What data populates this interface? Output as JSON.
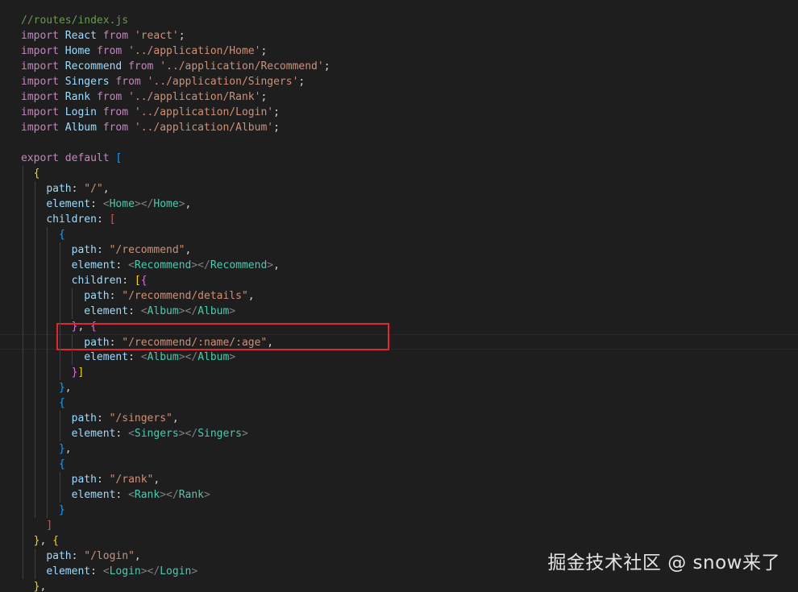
{
  "file_comment": "//routes/index.js",
  "colors": {
    "background": "#1e1e1e",
    "comment": "#6a9955",
    "keyword": "#c586c0",
    "variable": "#9cdcfe",
    "string": "#ce9178",
    "tag": "#4ec9b0",
    "highlight_box": "#e0262e"
  },
  "lines": [
    [
      {
        "c": "t-comment",
        "t": "//routes/index.js"
      }
    ],
    [
      {
        "c": "t-keyword",
        "t": "import"
      },
      {
        "c": "t-plain",
        "t": " "
      },
      {
        "c": "t-var",
        "t": "React"
      },
      {
        "c": "t-plain",
        "t": " "
      },
      {
        "c": "t-keyword",
        "t": "from"
      },
      {
        "c": "t-plain",
        "t": " "
      },
      {
        "c": "t-string",
        "t": "'react'"
      },
      {
        "c": "t-plain",
        "t": ";"
      }
    ],
    [
      {
        "c": "t-keyword",
        "t": "import"
      },
      {
        "c": "t-plain",
        "t": " "
      },
      {
        "c": "t-var",
        "t": "Home"
      },
      {
        "c": "t-plain",
        "t": " "
      },
      {
        "c": "t-keyword",
        "t": "from"
      },
      {
        "c": "t-plain",
        "t": " "
      },
      {
        "c": "t-string",
        "t": "'../application/Home'"
      },
      {
        "c": "t-plain",
        "t": ";"
      }
    ],
    [
      {
        "c": "t-keyword",
        "t": "import"
      },
      {
        "c": "t-plain",
        "t": " "
      },
      {
        "c": "t-var",
        "t": "Recommend"
      },
      {
        "c": "t-plain",
        "t": " "
      },
      {
        "c": "t-keyword",
        "t": "from"
      },
      {
        "c": "t-plain",
        "t": " "
      },
      {
        "c": "t-string",
        "t": "'../application/Recommend'"
      },
      {
        "c": "t-plain",
        "t": ";"
      }
    ],
    [
      {
        "c": "t-keyword",
        "t": "import"
      },
      {
        "c": "t-plain",
        "t": " "
      },
      {
        "c": "t-var",
        "t": "Singers"
      },
      {
        "c": "t-plain",
        "t": " "
      },
      {
        "c": "t-keyword",
        "t": "from"
      },
      {
        "c": "t-plain",
        "t": " "
      },
      {
        "c": "t-string",
        "t": "'../application/Singers'"
      },
      {
        "c": "t-plain",
        "t": ";"
      }
    ],
    [
      {
        "c": "t-keyword",
        "t": "import"
      },
      {
        "c": "t-plain",
        "t": " "
      },
      {
        "c": "t-var",
        "t": "Rank"
      },
      {
        "c": "t-plain",
        "t": " "
      },
      {
        "c": "t-keyword",
        "t": "from"
      },
      {
        "c": "t-plain",
        "t": " "
      },
      {
        "c": "t-string",
        "t": "'../application/Rank'"
      },
      {
        "c": "t-plain",
        "t": ";"
      }
    ],
    [
      {
        "c": "t-keyword",
        "t": "import"
      },
      {
        "c": "t-plain",
        "t": " "
      },
      {
        "c": "t-var",
        "t": "Login"
      },
      {
        "c": "t-plain",
        "t": " "
      },
      {
        "c": "t-keyword",
        "t": "from"
      },
      {
        "c": "t-plain",
        "t": " "
      },
      {
        "c": "t-string",
        "t": "'../application/Login'"
      },
      {
        "c": "t-plain",
        "t": ";"
      }
    ],
    [
      {
        "c": "t-keyword",
        "t": "import"
      },
      {
        "c": "t-plain",
        "t": " "
      },
      {
        "c": "t-var",
        "t": "Album"
      },
      {
        "c": "t-plain",
        "t": " "
      },
      {
        "c": "t-keyword",
        "t": "from"
      },
      {
        "c": "t-plain",
        "t": " "
      },
      {
        "c": "t-string",
        "t": "'../application/Album'"
      },
      {
        "c": "t-plain",
        "t": ";"
      }
    ],
    [],
    [
      {
        "c": "t-keyword",
        "t": "export"
      },
      {
        "c": "t-plain",
        "t": " "
      },
      {
        "c": "t-keyword",
        "t": "default"
      },
      {
        "c": "t-plain",
        "t": " "
      },
      {
        "c": "t-bracket-b",
        "t": "["
      }
    ],
    [
      {
        "c": "t-plain",
        "t": "  "
      },
      {
        "c": "t-bracket-y",
        "t": "{"
      }
    ],
    [
      {
        "c": "t-plain",
        "t": "    "
      },
      {
        "c": "t-var",
        "t": "path"
      },
      {
        "c": "t-plain",
        "t": ": "
      },
      {
        "c": "t-string",
        "t": "\"/\""
      },
      {
        "c": "t-plain",
        "t": ","
      }
    ],
    [
      {
        "c": "t-plain",
        "t": "    "
      },
      {
        "c": "t-var",
        "t": "element"
      },
      {
        "c": "t-plain",
        "t": ": "
      },
      {
        "c": "t-tagbr",
        "t": "<"
      },
      {
        "c": "t-tag",
        "t": "Home"
      },
      {
        "c": "t-tagbr",
        "t": "></"
      },
      {
        "c": "t-tag",
        "t": "Home"
      },
      {
        "c": "t-tagbr",
        "t": ">"
      },
      {
        "c": "t-plain",
        "t": ","
      }
    ],
    [
      {
        "c": "t-plain",
        "t": "    "
      },
      {
        "c": "t-var",
        "t": "children"
      },
      {
        "c": "t-plain",
        "t": ": "
      },
      {
        "c": "t-bracket-red",
        "t": "["
      }
    ],
    [
      {
        "c": "t-plain",
        "t": "      "
      },
      {
        "c": "t-bracket-b",
        "t": "{"
      }
    ],
    [
      {
        "c": "t-plain",
        "t": "        "
      },
      {
        "c": "t-var",
        "t": "path"
      },
      {
        "c": "t-plain",
        "t": ": "
      },
      {
        "c": "t-string",
        "t": "\"/recommend\""
      },
      {
        "c": "t-plain",
        "t": ","
      }
    ],
    [
      {
        "c": "t-plain",
        "t": "        "
      },
      {
        "c": "t-var",
        "t": "element"
      },
      {
        "c": "t-plain",
        "t": ": "
      },
      {
        "c": "t-tagbr",
        "t": "<"
      },
      {
        "c": "t-tag",
        "t": "Recommend"
      },
      {
        "c": "t-tagbr",
        "t": "></"
      },
      {
        "c": "t-tag",
        "t": "Recommend"
      },
      {
        "c": "t-tagbr",
        "t": ">"
      },
      {
        "c": "t-plain",
        "t": ","
      }
    ],
    [
      {
        "c": "t-plain",
        "t": "        "
      },
      {
        "c": "t-var",
        "t": "children"
      },
      {
        "c": "t-plain",
        "t": ": "
      },
      {
        "c": "t-bracket-y",
        "t": "["
      },
      {
        "c": "t-bracket-p",
        "t": "{"
      }
    ],
    [
      {
        "c": "t-plain",
        "t": "          "
      },
      {
        "c": "t-var",
        "t": "path"
      },
      {
        "c": "t-plain",
        "t": ": "
      },
      {
        "c": "t-string",
        "t": "\"/recommend/details\""
      },
      {
        "c": "t-plain",
        "t": ","
      }
    ],
    [
      {
        "c": "t-plain",
        "t": "          "
      },
      {
        "c": "t-var",
        "t": "element"
      },
      {
        "c": "t-plain",
        "t": ": "
      },
      {
        "c": "t-tagbr",
        "t": "<"
      },
      {
        "c": "t-tag",
        "t": "Album"
      },
      {
        "c": "t-tagbr",
        "t": "></"
      },
      {
        "c": "t-tag",
        "t": "Album"
      },
      {
        "c": "t-tagbr",
        "t": ">"
      }
    ],
    [
      {
        "c": "t-plain",
        "t": "        "
      },
      {
        "c": "t-bracket-p",
        "t": "}"
      },
      {
        "c": "t-plain",
        "t": ", "
      },
      {
        "c": "t-bracket-p",
        "t": "{"
      }
    ],
    [
      {
        "c": "t-plain",
        "t": "          "
      },
      {
        "c": "t-var",
        "t": "path"
      },
      {
        "c": "t-plain",
        "t": ": "
      },
      {
        "c": "t-string",
        "t": "\"/recommend/:name/:age\""
      },
      {
        "c": "t-plain",
        "t": ","
      }
    ],
    [
      {
        "c": "t-plain",
        "t": "          "
      },
      {
        "c": "t-var",
        "t": "element"
      },
      {
        "c": "t-plain",
        "t": ": "
      },
      {
        "c": "t-tagbr",
        "t": "<"
      },
      {
        "c": "t-tag",
        "t": "Album"
      },
      {
        "c": "t-tagbr",
        "t": "></"
      },
      {
        "c": "t-tag",
        "t": "Album"
      },
      {
        "c": "t-tagbr",
        "t": ">"
      }
    ],
    [
      {
        "c": "t-plain",
        "t": "        "
      },
      {
        "c": "t-bracket-p",
        "t": "}"
      },
      {
        "c": "t-bracket-y",
        "t": "]"
      }
    ],
    [
      {
        "c": "t-plain",
        "t": "      "
      },
      {
        "c": "t-bracket-b",
        "t": "}"
      },
      {
        "c": "t-plain",
        "t": ","
      }
    ],
    [
      {
        "c": "t-plain",
        "t": "      "
      },
      {
        "c": "t-bracket-b",
        "t": "{"
      }
    ],
    [
      {
        "c": "t-plain",
        "t": "        "
      },
      {
        "c": "t-var",
        "t": "path"
      },
      {
        "c": "t-plain",
        "t": ": "
      },
      {
        "c": "t-string",
        "t": "\"/singers\""
      },
      {
        "c": "t-plain",
        "t": ","
      }
    ],
    [
      {
        "c": "t-plain",
        "t": "        "
      },
      {
        "c": "t-var",
        "t": "element"
      },
      {
        "c": "t-plain",
        "t": ": "
      },
      {
        "c": "t-tagbr",
        "t": "<"
      },
      {
        "c": "t-tag",
        "t": "Singers"
      },
      {
        "c": "t-tagbr",
        "t": "></"
      },
      {
        "c": "t-tag",
        "t": "Singers"
      },
      {
        "c": "t-tagbr",
        "t": ">"
      }
    ],
    [
      {
        "c": "t-plain",
        "t": "      "
      },
      {
        "c": "t-bracket-b",
        "t": "}"
      },
      {
        "c": "t-plain",
        "t": ","
      }
    ],
    [
      {
        "c": "t-plain",
        "t": "      "
      },
      {
        "c": "t-bracket-b",
        "t": "{"
      }
    ],
    [
      {
        "c": "t-plain",
        "t": "        "
      },
      {
        "c": "t-var",
        "t": "path"
      },
      {
        "c": "t-plain",
        "t": ": "
      },
      {
        "c": "t-string",
        "t": "\"/rank\""
      },
      {
        "c": "t-plain",
        "t": ","
      }
    ],
    [
      {
        "c": "t-plain",
        "t": "        "
      },
      {
        "c": "t-var",
        "t": "element"
      },
      {
        "c": "t-plain",
        "t": ": "
      },
      {
        "c": "t-tagbr",
        "t": "<"
      },
      {
        "c": "t-tag",
        "t": "Rank"
      },
      {
        "c": "t-tagbr",
        "t": "></"
      },
      {
        "c": "t-tag",
        "t": "Rank"
      },
      {
        "c": "t-tagbr",
        "t": ">"
      }
    ],
    [
      {
        "c": "t-plain",
        "t": "      "
      },
      {
        "c": "t-bracket-b",
        "t": "}"
      }
    ],
    [
      {
        "c": "t-plain",
        "t": "    "
      },
      {
        "c": "t-bracket-red",
        "t": "]"
      }
    ],
    [
      {
        "c": "t-plain",
        "t": "  "
      },
      {
        "c": "t-bracket-y",
        "t": "}"
      },
      {
        "c": "t-plain",
        "t": ", "
      },
      {
        "c": "t-bracket-y",
        "t": "{"
      }
    ],
    [
      {
        "c": "t-plain",
        "t": "    "
      },
      {
        "c": "t-var",
        "t": "path"
      },
      {
        "c": "t-plain",
        "t": ": "
      },
      {
        "c": "t-string",
        "t": "\"/login\""
      },
      {
        "c": "t-plain",
        "t": ","
      }
    ],
    [
      {
        "c": "t-plain",
        "t": "    "
      },
      {
        "c": "t-var",
        "t": "element"
      },
      {
        "c": "t-plain",
        "t": ": "
      },
      {
        "c": "t-tagbr",
        "t": "<"
      },
      {
        "c": "t-tag",
        "t": "Login"
      },
      {
        "c": "t-tagbr",
        "t": "></"
      },
      {
        "c": "t-tag",
        "t": "Login"
      },
      {
        "c": "t-tagbr",
        "t": ">"
      }
    ],
    [
      {
        "c": "t-plain",
        "t": "  "
      },
      {
        "c": "t-bracket-y",
        "t": "}"
      },
      {
        "c": "t-plain",
        "t": ","
      }
    ]
  ],
  "current_line_index": 21,
  "watermark": "掘金技术社区 @ snow来了"
}
